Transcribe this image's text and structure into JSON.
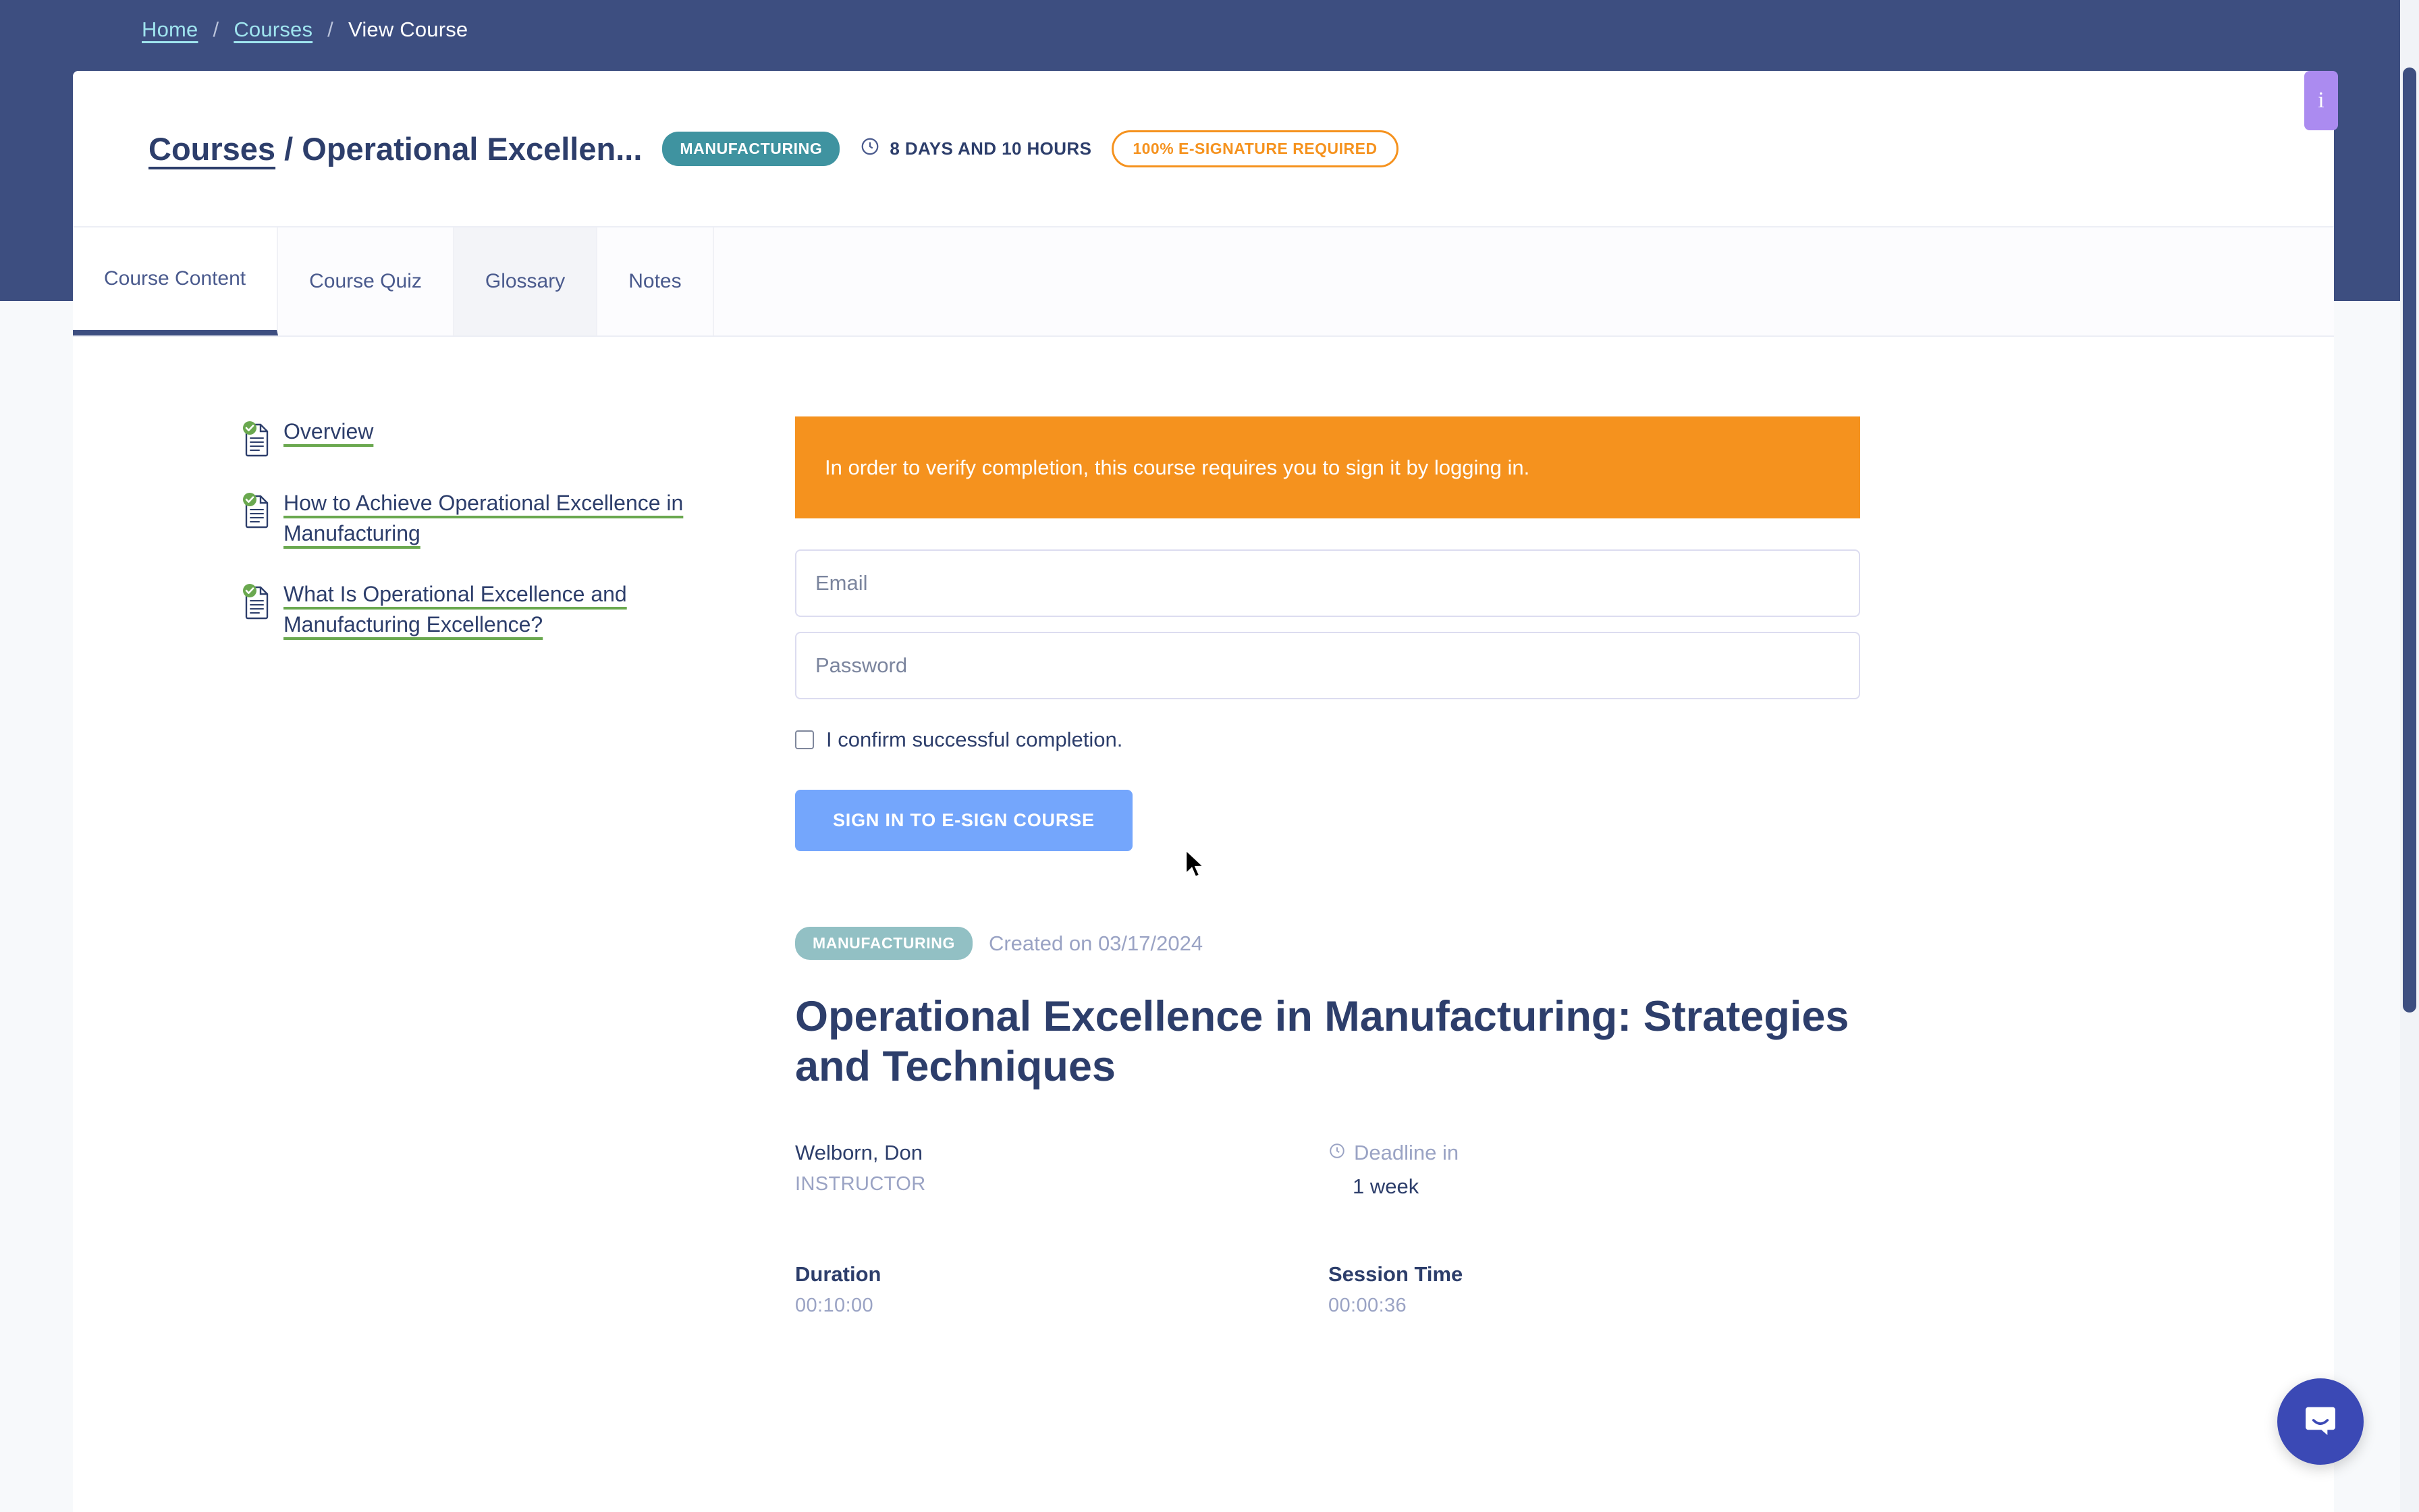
{
  "breadcrumb": {
    "home": "Home",
    "separator": "/",
    "courses": "Courses",
    "current": "View Course"
  },
  "course_header": {
    "parent_link": "Courses",
    "title_divider": " / ",
    "title": "Operational Excellen...",
    "category_badge": "MANUFACTURING",
    "duration_meta": "8 DAYS AND 10 HOURS",
    "esign_badge": "100% E-SIGNATURE REQUIRED"
  },
  "tabs": [
    {
      "label": "Course Content",
      "state": "active"
    },
    {
      "label": "Course Quiz",
      "state": "default"
    },
    {
      "label": "Glossary",
      "state": "hover"
    },
    {
      "label": "Notes",
      "state": "default"
    }
  ],
  "sidebar": {
    "lessons": [
      {
        "label": "Overview",
        "status": "complete"
      },
      {
        "label": "How to Achieve Operational Excellence in Manufacturing",
        "status": "complete"
      },
      {
        "label": "What Is Operational Excellence and Manufacturing Excellence?",
        "status": "complete"
      }
    ]
  },
  "esign": {
    "notice": "In order to verify completion, this course requires you to sign it by logging in.",
    "email_placeholder": "Email",
    "email_value": "",
    "password_placeholder": "Password",
    "password_value": "",
    "confirm_label": "I confirm successful completion.",
    "confirm_checked": false,
    "submit_label": "SIGN IN TO E-SIGN COURSE"
  },
  "course_detail": {
    "category_badge": "MANUFACTURING",
    "created_on": "Created on 03/17/2024",
    "title": "Operational Excellence in Manufacturing: Strategies and Techniques",
    "instructor_name": "Welborn, Don",
    "instructor_role": "INSTRUCTOR",
    "deadline_label": "Deadline in",
    "deadline_value": "1 week",
    "duration_label": "Duration",
    "duration_value": "00:10:00",
    "session_label": "Session Time",
    "session_value": "00:00:36"
  },
  "widgets": {
    "info_tab_label": "i",
    "chat_icon": "chat-bubble-icon"
  },
  "colors": {
    "header_blue": "#3d4e80",
    "accent_teal": "#3f93a0",
    "accent_orange": "#f5921e",
    "button_blue": "#74a6fc",
    "check_green": "#6aa84f",
    "muted_purple": "#9aa3c4",
    "info_tab_purple": "#ab8bf0",
    "chat_blue": "#3b49b5"
  }
}
